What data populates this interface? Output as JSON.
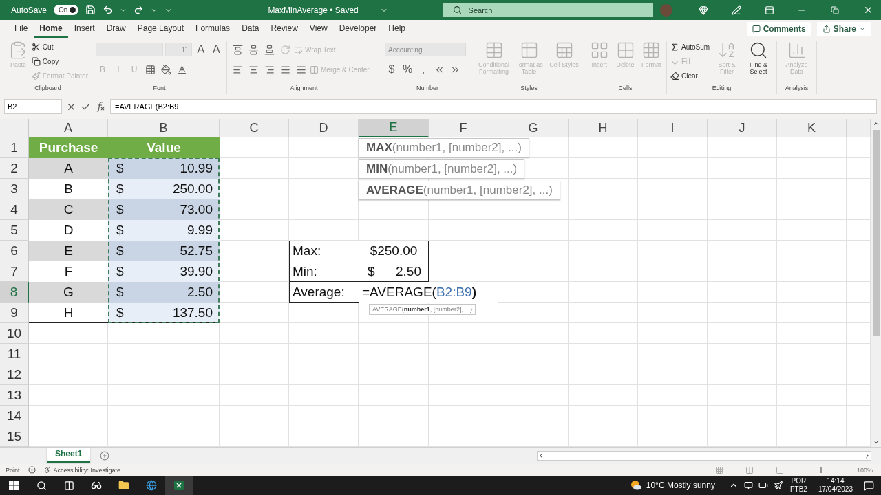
{
  "title_bar": {
    "autosave_label": "AutoSave",
    "autosave": {
      "label": "On",
      "on": true
    },
    "document_title": "MaxMinAverage • Saved",
    "search": {
      "placeholder": "Search"
    }
  },
  "menu_tabs": [
    {
      "label": "File",
      "selected": false
    },
    {
      "label": "Home",
      "selected": true
    },
    {
      "label": "Insert",
      "selected": false
    },
    {
      "label": "Draw",
      "selected": false
    },
    {
      "label": "Page Layout",
      "selected": false
    },
    {
      "label": "Formulas",
      "selected": false
    },
    {
      "label": "Data",
      "selected": false
    },
    {
      "label": "Review",
      "selected": false
    },
    {
      "label": "View",
      "selected": false
    },
    {
      "label": "Developer",
      "selected": false
    },
    {
      "label": "Help",
      "selected": false
    }
  ],
  "comments_button": "Comments",
  "share_button": "Share",
  "ribbon_groups": [
    {
      "title": "Clipboard",
      "items": [
        {
          "kind": "large",
          "label": "Paste",
          "disabled": true
        },
        {
          "kind": "small",
          "label": "Cut",
          "disabled": false
        },
        {
          "kind": "small",
          "label": "Copy",
          "disabled": false
        },
        {
          "kind": "small",
          "label": "Format Painter",
          "disabled": true
        }
      ]
    },
    {
      "title": "Font",
      "rows": [
        [
          {
            "kind": "field",
            "disabled": true
          },
          {
            "kind": "field",
            "value": "11",
            "disabled": true
          },
          {
            "kind": "glyph",
            "label": "A",
            "disabled": false
          },
          {
            "kind": "glyph",
            "label": "A",
            "disabled": false
          }
        ],
        [
          {
            "kind": "glyph",
            "label": "B",
            "disabled": true
          },
          {
            "kind": "glyph",
            "label": "I",
            "disabled": true
          },
          {
            "kind": "glyph",
            "label": "U",
            "disabled": true
          },
          {
            "kind": "icon",
            "disabled": false
          },
          {
            "kind": "icon",
            "disabled": false
          },
          {
            "kind": "icon",
            "disabled": false
          }
        ]
      ]
    },
    {
      "title": "Alignment",
      "rows": [
        [
          {
            "kind": "icon",
            "disabled": false
          },
          {
            "kind": "icon",
            "disabled": false
          },
          {
            "kind": "icon",
            "disabled": false
          },
          {
            "kind": "icon",
            "disabled": true
          },
          {
            "kind": "small",
            "label": "Wrap Text",
            "disabled": true
          }
        ],
        [
          {
            "kind": "icon",
            "disabled": false
          },
          {
            "kind": "icon",
            "disabled": false
          },
          {
            "kind": "icon",
            "disabled": false
          },
          {
            "kind": "icon",
            "disabled": false
          },
          {
            "kind": "icon",
            "disabled": false
          },
          {
            "kind": "small",
            "label": "Merge & Center",
            "disabled": true
          }
        ]
      ]
    },
    {
      "title": "Number",
      "rows": [
        [
          {
            "kind": "field",
            "value": "Accounting",
            "disabled": true
          }
        ],
        [
          {
            "kind": "glyph",
            "label": "$",
            "disabled": false
          },
          {
            "kind": "glyph",
            "label": "%",
            "disabled": false
          },
          {
            "kind": "glyph",
            "label": ",",
            "disabled": false
          },
          {
            "kind": "icon",
            "disabled": false
          },
          {
            "kind": "icon",
            "disabled": false
          }
        ]
      ]
    },
    {
      "title": "Styles",
      "items": [
        {
          "kind": "large",
          "label": "Conditional Formatting",
          "disabled": true
        },
        {
          "kind": "large",
          "label": "Format as Table",
          "disabled": true
        },
        {
          "kind": "large",
          "label": "Cell Styles",
          "disabled": true
        }
      ]
    },
    {
      "title": "Cells",
      "items": [
        {
          "kind": "large",
          "label": "Insert",
          "disabled": true
        },
        {
          "kind": "large",
          "label": "Delete",
          "disabled": true
        },
        {
          "kind": "large",
          "label": "Format",
          "disabled": true
        }
      ]
    },
    {
      "title": "Editing",
      "items": [
        {
          "kind": "small",
          "label": "AutoSum",
          "disabled": false
        },
        {
          "kind": "small",
          "label": "Fill",
          "disabled": true
        },
        {
          "kind": "small",
          "label": "Clear",
          "disabled": false
        },
        {
          "kind": "large",
          "label": "Sort & Filter",
          "disabled": true
        },
        {
          "kind": "large",
          "label": "Find & Select",
          "disabled": false
        }
      ]
    },
    {
      "title": "Analysis",
      "items": [
        {
          "kind": "large",
          "label": "Analyze Data",
          "disabled": true
        }
      ]
    }
  ],
  "formula_bar": {
    "name_box": "B2",
    "formula": "=AVERAGE(B2:B9"
  },
  "columns": [
    {
      "label": "A",
      "selected": false
    },
    {
      "label": "B",
      "selected": false
    },
    {
      "label": "C",
      "selected": false
    },
    {
      "label": "D",
      "selected": false
    },
    {
      "label": "E",
      "selected": true
    },
    {
      "label": "F",
      "selected": false
    },
    {
      "label": "G",
      "selected": false
    },
    {
      "label": "H",
      "selected": false
    },
    {
      "label": "I",
      "selected": false
    },
    {
      "label": "J",
      "selected": false
    },
    {
      "label": "K",
      "selected": false
    }
  ],
  "rows": [
    {
      "label": "1",
      "selected": false
    },
    {
      "label": "2",
      "selected": false
    },
    {
      "label": "3",
      "selected": false
    },
    {
      "label": "4",
      "selected": false
    },
    {
      "label": "5",
      "selected": false
    },
    {
      "label": "6",
      "selected": false
    },
    {
      "label": "7",
      "selected": false
    },
    {
      "label": "8",
      "selected": true
    },
    {
      "label": "9",
      "selected": false
    },
    {
      "label": "10",
      "selected": false
    },
    {
      "label": "11",
      "selected": false
    },
    {
      "label": "12",
      "selected": false
    },
    {
      "label": "13",
      "selected": false
    },
    {
      "label": "14",
      "selected": false
    },
    {
      "label": "15",
      "selected": false
    }
  ],
  "purchases": {
    "headers": [
      "Purchase",
      "Value"
    ],
    "rows": [
      {
        "purchase": "A",
        "currency": "$",
        "value": "10.99"
      },
      {
        "purchase": "B",
        "currency": "$",
        "value": "250.00"
      },
      {
        "purchase": "C",
        "currency": "$",
        "value": "73.00"
      },
      {
        "purchase": "D",
        "currency": "$",
        "value": "9.99"
      },
      {
        "purchase": "E",
        "currency": "$",
        "value": "52.75"
      },
      {
        "purchase": "F",
        "currency": "$",
        "value": "39.90"
      },
      {
        "purchase": "G",
        "currency": "$",
        "value": "2.50"
      },
      {
        "purchase": "H",
        "currency": "$",
        "value": "137.50"
      }
    ]
  },
  "summary": [
    {
      "kind": "value",
      "label": "Max:",
      "value": "$250.00"
    },
    {
      "kind": "split",
      "label": "Min:",
      "currency": "$",
      "value": "2.50"
    },
    {
      "kind": "editing",
      "label": "Average:",
      "formula_start": "=AVERAGE(",
      "reference": "B2:B9",
      "formula_end": ")"
    }
  ],
  "autocomplete": [
    "**MAX**(number1, [number2], ...)",
    "**MIN**(number1, [number2], ...)",
    "**AVERAGE**(number1, [number2], ...)"
  ],
  "tooltip": "AVERAGE(**number1**, [number2], ...)",
  "sheet_tabs": [
    {
      "label": "Sheet1",
      "selected": true
    }
  ],
  "status_bar": {
    "mode": "Point",
    "accessibility": "Accessibility: Investigate",
    "zoom": {
      "level": 0.5,
      "label": "100%"
    }
  },
  "taskbar": {
    "weather": "10°C Mostly sunny",
    "language": "POR",
    "keyboard": "PTB2",
    "time": "14:14",
    "date": "17/04/2023"
  }
}
